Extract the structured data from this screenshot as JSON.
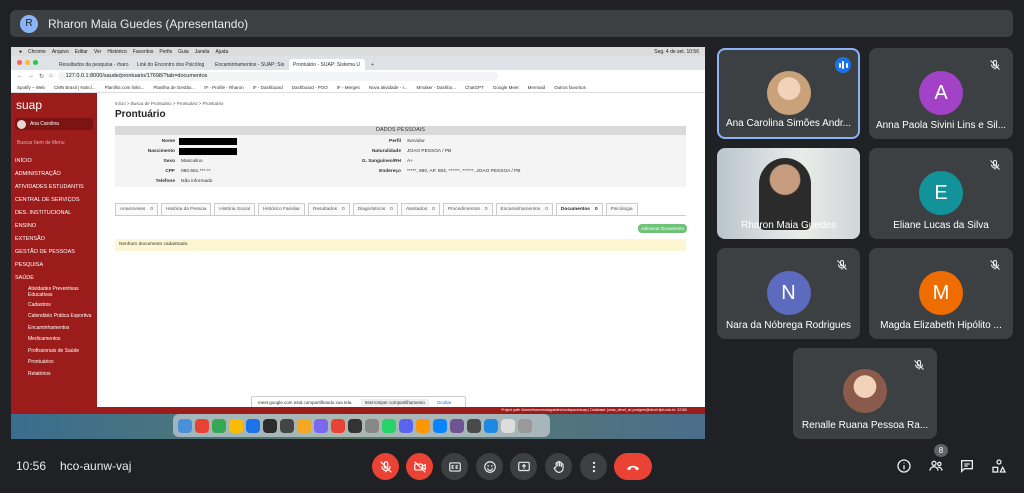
{
  "presenter": {
    "initial": "R",
    "title": "Rharon Maia Guedes (Apresentando)"
  },
  "shared": {
    "mac_menu": [
      "Chrome",
      "Arquivo",
      "Editar",
      "Ver",
      "Histórico",
      "Favoritos",
      "Perfis",
      "Guia",
      "Janela",
      "Ajuda"
    ],
    "mac_clock": "Seg. 4 de set. 10:56",
    "tabs": [
      {
        "label": "Resultados da pesquisa - rharo",
        "active": false
      },
      {
        "label": "Link do Encontro dos Psicólog",
        "active": false
      },
      {
        "label": "Encaminhamentos - SUAP: Sis",
        "active": false
      },
      {
        "label": "Prontuário - SUAP: Sistema U",
        "active": true
      }
    ],
    "url": "127.0.0.1:8000/saude/prontuario/17698/?tab=documentos",
    "bookmarks": [
      "Spotify – Web",
      "CMN Brasil | Noticí...",
      "Planilha com links...",
      "Planilha de Gestão...",
      "IF - Profile - Rharon",
      "IF - Dashboard",
      "Dashboard - POO",
      "IF - Merges",
      "Nova atividade - I...",
      "Mmaker - Dashbo...",
      "ChatGPT",
      "Google Meet",
      "Mermaid",
      "Outros favoritos"
    ],
    "suap": {
      "logo": "suap",
      "user": "Ana Carolina",
      "search_placeholder": "Buscar Item de Menu",
      "menu": [
        {
          "label": "INÍCIO",
          "type": "main"
        },
        {
          "label": "ADMINISTRAÇÃO",
          "type": "main"
        },
        {
          "label": "ATIVIDADES ESTUDANTIS",
          "type": "main"
        },
        {
          "label": "CENTRAL DE SERVIÇOS",
          "type": "main"
        },
        {
          "label": "DES. INSTITUCIONAL",
          "type": "main"
        },
        {
          "label": "ENSINO",
          "type": "main"
        },
        {
          "label": "EXTENSÃO",
          "type": "main"
        },
        {
          "label": "GESTÃO DE PESSOAS",
          "type": "main"
        },
        {
          "label": "PESQUISA",
          "type": "main"
        },
        {
          "label": "SAÚDE",
          "type": "main"
        },
        {
          "label": "Atividades Preventivas Educativas",
          "type": "sub2"
        },
        {
          "label": "Cadastros",
          "type": "sub"
        },
        {
          "label": "Calendário Prática Esportiva",
          "type": "sub"
        },
        {
          "label": "Encaminhamentos",
          "type": "sub"
        },
        {
          "label": "Medicamentos",
          "type": "sub"
        },
        {
          "label": "Profissionais de Saúde",
          "type": "sub"
        },
        {
          "label": "Prontuários",
          "type": "sub"
        },
        {
          "label": "Relatórios",
          "type": "sub"
        }
      ],
      "breadcrumb": "Início > Busca de Prontuário > Prontuário > Prontuário",
      "page_title": "Prontuário",
      "section_title": "DADOS PESSOAIS",
      "fields": {
        "nome_label": "Nome",
        "nascimento_label": "Nascimento",
        "sexo_label": "Sexo",
        "sexo": "Masculino",
        "cpf_label": "CPF",
        "cpf": "090.561.***-**",
        "telefone_label": "Telefone",
        "telefone": "Não informado",
        "perfil_label": "Perfil",
        "perfil": "Servidor",
        "naturalidade_label": "Naturalidade",
        "naturalidade": "JOAO PESSOA / PB",
        "sangue_label": "G. Sanguíneo/RH",
        "sangue": "A+",
        "endereco_label": "Endereço",
        "endereco": "*****, 950, AP. 804, ******, ******, JOAO PESSOA / PB"
      },
      "ptabs": [
        {
          "label": "Anamneses",
          "count": "0",
          "active": false
        },
        {
          "label": "História da Pessoa",
          "count": "",
          "active": false
        },
        {
          "label": "História Social",
          "count": "",
          "active": false
        },
        {
          "label": "Histórico Familiar",
          "count": "",
          "active": false
        },
        {
          "label": "Resultados",
          "count": "0",
          "active": false
        },
        {
          "label": "Diagnósticos",
          "count": "0",
          "active": false
        },
        {
          "label": "Atestados",
          "count": "0",
          "active": false
        },
        {
          "label": "Procedimentos",
          "count": "0",
          "active": false
        },
        {
          "label": "Encaminhamentos",
          "count": "0",
          "active": false
        },
        {
          "label": "Documentos",
          "count": "0",
          "active": true
        },
        {
          "label": "Psicologia",
          "count": "",
          "active": false
        }
      ],
      "add_button": "Adicionar Documento",
      "empty_message": "Nenhum documento cadastrado.",
      "share_text": "meet.google.com está compartilhando sua tela.",
      "share_stop": "Interromper compartilhamento",
      "share_hide": "Ocultar",
      "footer_text": "Project path /Users/rharonmaiaguedes/workspace/suap | Database: jonas_devel_sb postgres@devel.ifpb.edu.br: 32150"
    }
  },
  "participants": [
    {
      "name": "Ana Carolina Simões Andr...",
      "kind": "photo",
      "speaking": true,
      "muted": false,
      "color": "#c9a27a"
    },
    {
      "name": "Anna Paola Sivini Lins e Sil...",
      "initial": "A",
      "kind": "initial",
      "muted": true,
      "color": "#a142c7"
    },
    {
      "name": "Rharon Maia Guedes",
      "kind": "video",
      "muted": false,
      "color": "#6d5b4f"
    },
    {
      "name": "Eliane Lucas da Silva",
      "initial": "E",
      "kind": "initial",
      "muted": true,
      "color": "#12939a"
    },
    {
      "name": "Nara da Nóbrega Rodrigues",
      "initial": "N",
      "kind": "initial",
      "muted": true,
      "color": "#5c6bc0"
    },
    {
      "name": "Magda Elizabeth Hipólito ...",
      "initial": "M",
      "kind": "initial",
      "muted": true,
      "color": "#ef6c00"
    },
    {
      "name": "Renalle Ruana Pessoa Ra...",
      "kind": "photo",
      "muted": true,
      "color": "#8a5a4a"
    }
  ],
  "bottom": {
    "clock": "10:56",
    "meeting_code": "hco-aunw-vaj",
    "people_count": "8",
    "controls": [
      "mic-off-icon",
      "camera-off-icon",
      "captions-icon",
      "emoji-icon",
      "present-icon",
      "raise-hand-icon",
      "more-options-icon",
      "end-call-icon"
    ],
    "right_icons": [
      "info-icon",
      "people-icon",
      "chat-icon",
      "activities-icon"
    ]
  }
}
